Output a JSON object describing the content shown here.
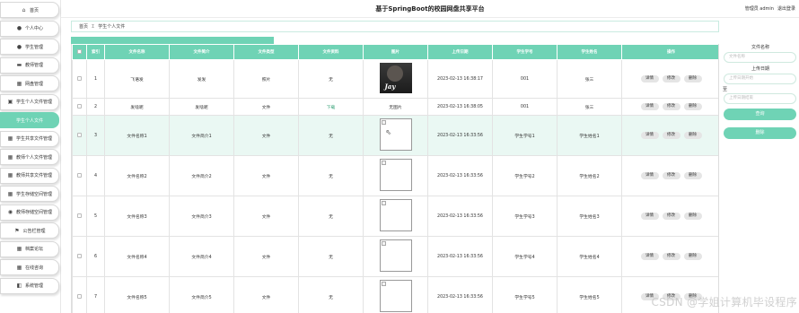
{
  "header": {
    "title": "基于SpringBoot的校园网盘共享平台",
    "user_label": "管理员 admin",
    "logout_label": "退出登录"
  },
  "sidebar": {
    "items": [
      {
        "label": "首页",
        "icon": "home-icon",
        "glyph": "⌂"
      },
      {
        "label": "个人中心",
        "icon": "person-icon",
        "glyph": "●"
      },
      {
        "label": "学生管理",
        "icon": "student-icon",
        "glyph": "●"
      },
      {
        "label": "教师管理",
        "icon": "teacher-icon",
        "glyph": "▬"
      },
      {
        "label": "网盘管理",
        "icon": "grid-icon",
        "glyph": "▦"
      },
      {
        "label": "学生个人文件管理",
        "icon": "file-icon",
        "glyph": "▣"
      },
      {
        "label": "学生个人文件",
        "icon": "",
        "glyph": "",
        "active": true
      },
      {
        "label": "学生共享文件管理",
        "icon": "share-icon",
        "glyph": "▦"
      },
      {
        "label": "教师个人文件管理",
        "icon": "folder-icon",
        "glyph": "▦"
      },
      {
        "label": "教师共享文件管理",
        "icon": "grid-icon",
        "glyph": "▦"
      },
      {
        "label": "学生存储空间管理",
        "icon": "grid-icon",
        "glyph": "▦"
      },
      {
        "label": "教师存储空间管理",
        "icon": "storage-icon",
        "glyph": "◉"
      },
      {
        "label": "公告栏管理",
        "icon": "flag-icon",
        "glyph": "⚑"
      },
      {
        "label": "档案论坛",
        "icon": "grid-icon",
        "glyph": "▦"
      },
      {
        "label": "在线咨询",
        "icon": "grid-icon",
        "glyph": "▦"
      },
      {
        "label": "系统管理",
        "icon": "settings-icon",
        "glyph": "◧"
      }
    ]
  },
  "breadcrumb": {
    "home": "首页",
    "separator": "Σ",
    "current": "学生个人文件"
  },
  "table": {
    "headers": [
      "",
      "索引",
      "文件名称",
      "文件简介",
      "文件类型",
      "文件资料",
      "图片",
      "上传日期",
      "学生学号",
      "学生姓名",
      "操作"
    ],
    "rows": [
      {
        "index": "1",
        "name": "飞语发",
        "intro": "发发",
        "type": "照片",
        "material": "无",
        "image": "photo",
        "date": "2023-02-13 16:38:17",
        "student_no": "001",
        "student_name": "张三"
      },
      {
        "index": "2",
        "name": "发啥呢",
        "intro": "发啥呢",
        "type": "文件",
        "material": "下载",
        "image": "none",
        "image_text": "无图片",
        "date": "2023-02-13 16:38:05",
        "student_no": "001",
        "student_name": "张三"
      },
      {
        "index": "3",
        "name": "文件名称1",
        "intro": "文件简介1",
        "type": "文件",
        "material": "无",
        "image": "broken",
        "date": "2023-02-13 16:33:56",
        "student_no": "学生学号1",
        "student_name": "学生姓名1"
      },
      {
        "index": "4",
        "name": "文件名称2",
        "intro": "文件简介2",
        "type": "文件",
        "material": "无",
        "image": "broken",
        "date": "2023-02-13 16:33:56",
        "student_no": "学生学号2",
        "student_name": "学生姓名2"
      },
      {
        "index": "5",
        "name": "文件名称3",
        "intro": "文件简介3",
        "type": "文件",
        "material": "无",
        "image": "broken",
        "date": "2023-02-13 16:33:56",
        "student_no": "学生学号3",
        "student_name": "学生姓名3"
      },
      {
        "index": "6",
        "name": "文件名称4",
        "intro": "文件简介4",
        "type": "文件",
        "material": "无",
        "image": "broken",
        "date": "2023-02-13 16:33:56",
        "student_no": "学生学号4",
        "student_name": "学生姓名4"
      },
      {
        "index": "7",
        "name": "文件名称5",
        "intro": "文件简介5",
        "type": "文件",
        "material": "无",
        "image": "broken",
        "date": "2023-02-13 16:33:56",
        "student_no": "学生学号5",
        "student_name": "学生姓名5"
      }
    ],
    "actions": [
      "详情",
      "修改",
      "删除"
    ],
    "photo_caption": "Jay"
  },
  "search": {
    "file_name_label": "文件名称",
    "file_name_placeholder": "文件名称",
    "date_label": "上传日期",
    "date_start_placeholder": "上传日期开始",
    "to_label": "至",
    "date_end_placeholder": "上传日期结束",
    "search_button": "查询",
    "delete_button": "删除"
  },
  "watermark": "CSDN @学姐计算机毕设程序",
  "colors": {
    "accent": "#6fd3b5",
    "row_highlight": "#eaf8f3"
  }
}
